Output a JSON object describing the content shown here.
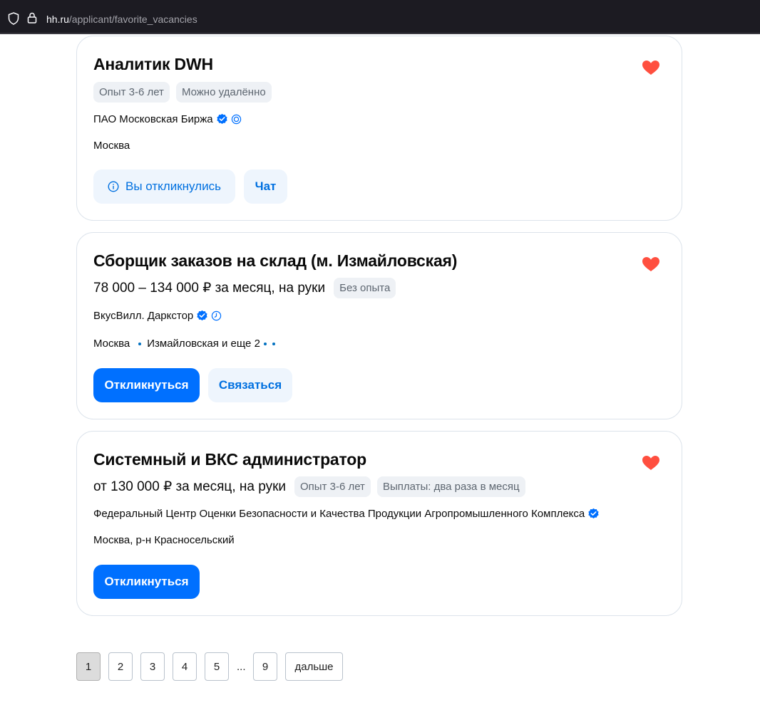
{
  "browser": {
    "url_host": "hh.ru",
    "url_path": "/applicant/favorite_vacancies"
  },
  "vacancies": [
    {
      "title": "Аналитик DWH",
      "tags": [
        "Опыт 3-6 лет",
        "Можно удалённо"
      ],
      "company": "ПАО Московская Биржа",
      "city": "Москва",
      "buttons": [
        "Вы откликнулись",
        "Чат"
      ]
    },
    {
      "title": "Сборщик заказов на склад (м. Измайловская)",
      "salary": "78 000 – 134 000 ₽ за месяц, на руки",
      "tags": [
        "Без опыта"
      ],
      "company": "ВкусВилл. Даркстор",
      "city": "Москва",
      "metro": "Измайловская и еще 2",
      "buttons": [
        "Откликнуться",
        "Связаться"
      ]
    },
    {
      "title": "Системный и ВКС администратор",
      "salary": "от 130 000 ₽ за месяц, на руки",
      "tags": [
        "Опыт 3-6 лет",
        "Выплаты: два раза в месяц"
      ],
      "company": "Федеральный Центр Оценки Безопасности и Качества Продукции Агропромышленного Комплекса",
      "city": "Москва, р-н Красносельский",
      "buttons": [
        "Откликнуться"
      ]
    }
  ],
  "pagination": {
    "pages": [
      "1",
      "2",
      "3",
      "4",
      "5"
    ],
    "ellipsis": "...",
    "last": "9",
    "next": "дальше",
    "current": "1"
  },
  "colors": {
    "accent": "#0070ff",
    "heart": "#ff4f3f",
    "verified": "#0070ff"
  }
}
